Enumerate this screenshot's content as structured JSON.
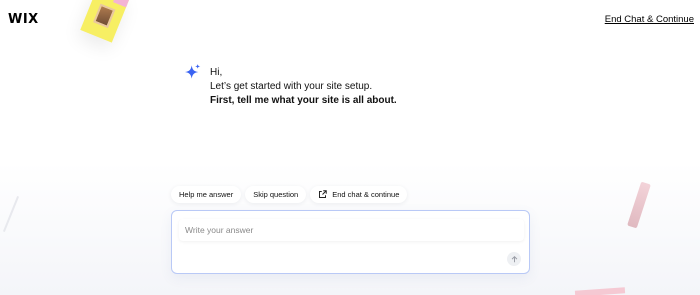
{
  "header": {
    "logo": "WIX",
    "end_link": "End Chat & Continue"
  },
  "chat": {
    "assistant_icon": "sparkle-icon",
    "lines": [
      "Hi,",
      "Let’s get started with your site setup.",
      "First, tell me what your site is all about."
    ]
  },
  "actions": {
    "help_label": "Help me answer",
    "skip_label": "Skip question",
    "end_label": "End chat & continue",
    "end_icon": "external-link-icon"
  },
  "input": {
    "placeholder": "Write your answer",
    "send_icon": "arrow-up-icon"
  },
  "colors": {
    "accent": "#3a63f2",
    "input_border": "#b9c9f6"
  }
}
